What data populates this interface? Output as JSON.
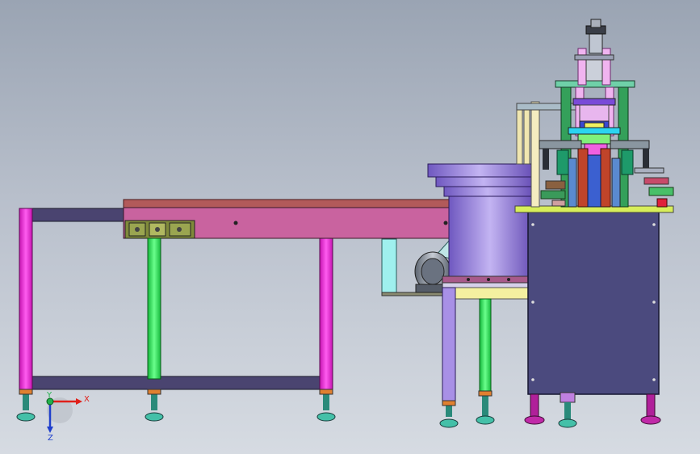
{
  "triad": {
    "x_label": "X",
    "y_label": "Y",
    "z_label": "Z",
    "x_color": "#e0201a",
    "y_color": "#22b14c",
    "z_color": "#1f3fcc"
  },
  "colors": {
    "table_leg": "#f02ce0",
    "table_frame": "#4a4470",
    "conveyor_body": "#c9639f",
    "conveyor_top": "#b25a5a",
    "green_post": "#2ee05a",
    "bowl": "#8c74d8",
    "cabinet": "#4b4a7e",
    "bench_top": "#d8ee5a",
    "cabinet_foot": "#b0209a"
  }
}
